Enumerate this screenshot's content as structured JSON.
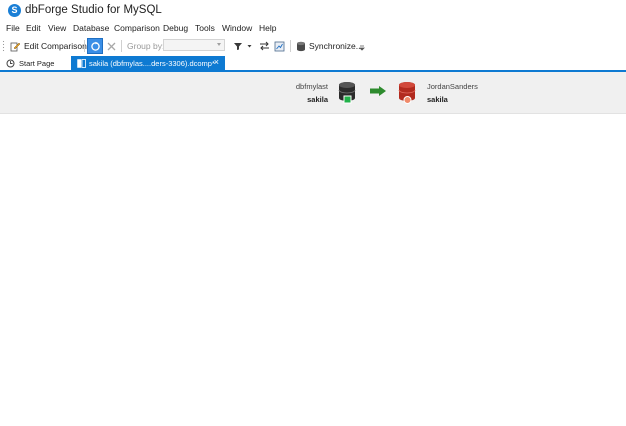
{
  "app": {
    "title": "dbForge Studio for MySQL",
    "logo_letter": "S"
  },
  "menu": [
    "File",
    "Edit",
    "View",
    "Database",
    "Comparison",
    "Debug",
    "Tools",
    "Window",
    "Help"
  ],
  "toolbar": {
    "edit_comparison_label": "Edit Comparison...",
    "group_by_label": "Group by:",
    "group_by_value": "",
    "synchronize_label": "Synchronize..."
  },
  "tabs": {
    "start_page": "Start Page",
    "active": "sakila (dbfmylas....ders-3306).dcomp*",
    "close": "×"
  },
  "comparison": {
    "source": {
      "connection": "dbfmylast",
      "database": "sakila"
    },
    "target": {
      "connection": "JordanSanders",
      "database": "sakila"
    }
  },
  "colors": {
    "accent": "#0e7ad2",
    "source_status": "#21b14a",
    "target_db": "#c0392b",
    "arrow": "#2e8b2e"
  }
}
